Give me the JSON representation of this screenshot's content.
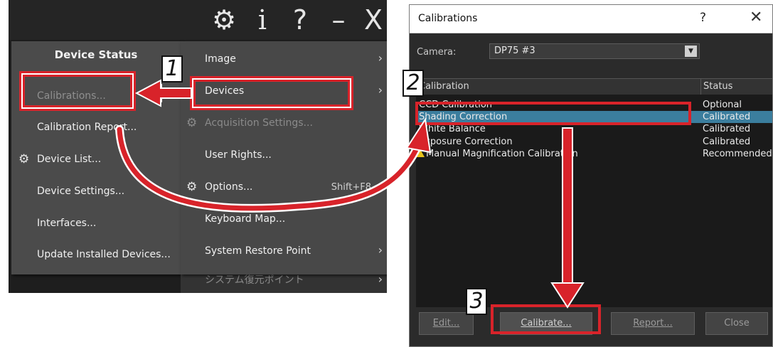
{
  "left_panel": {
    "title_bar_icons": {
      "gear": "⚙",
      "info": "i",
      "help": "?",
      "minimize": "–",
      "close": "X"
    },
    "device_menu": {
      "title": "Device Status",
      "items": [
        {
          "label": "Calibrations...",
          "enabled": false
        },
        {
          "label": "Calibration Report...",
          "enabled": true
        },
        {
          "label": "Device List...",
          "enabled": true,
          "icon": "gear-icon"
        },
        {
          "label": "Device Settings...",
          "enabled": true
        },
        {
          "label": "Interfaces...",
          "enabled": true
        },
        {
          "label": "Update Installed Devices...",
          "enabled": true
        }
      ]
    },
    "settings_menu": {
      "items": [
        {
          "label": "Image",
          "submenu": true
        },
        {
          "label": "Devices",
          "submenu": true
        },
        {
          "label": "Acquisition Settings...",
          "enabled": false,
          "icon": "gear-icon"
        },
        {
          "label": "User Rights..."
        },
        {
          "label": "Options...",
          "shortcut": "Shift+F8",
          "icon": "gear-icon"
        },
        {
          "label": "Keyboard Map..."
        },
        {
          "label": "System Restore Point",
          "submenu": true
        }
      ],
      "underlay_label": "システム復元ポイント"
    }
  },
  "annotations": {
    "step1": "1",
    "step2": "2",
    "step3": "3",
    "highlight_color": "#d8232a"
  },
  "dialog": {
    "title": "Calibrations",
    "help": "?",
    "close": "✕",
    "camera_label": "Camera:",
    "camera_value": "DP75 #3",
    "columns": {
      "calibration": "Calibration",
      "status": "Status"
    },
    "rows": [
      {
        "calibration": "CCD Calibration",
        "status": "Optional"
      },
      {
        "calibration": "Shading Correction",
        "status": "Calibrated",
        "selected": true
      },
      {
        "calibration": "White Balance",
        "status": "Calibrated"
      },
      {
        "calibration": "Exposure Correction",
        "status": "Calibrated"
      },
      {
        "calibration": "Manual Magnification Calibration",
        "status": "Recommended",
        "warning": true
      }
    ],
    "buttons": {
      "edit": "Edit...",
      "calibrate": "Calibrate...",
      "report": "Report...",
      "close": "Close"
    },
    "selection_color": "#3b7e9e"
  }
}
